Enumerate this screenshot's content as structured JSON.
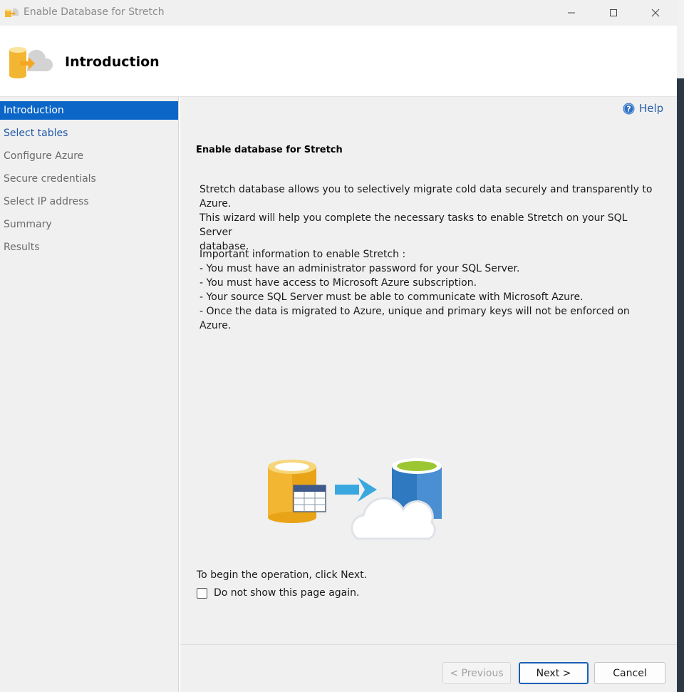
{
  "window": {
    "title": "Enable Database for Stretch"
  },
  "header": {
    "title": "Introduction"
  },
  "nav": {
    "items": [
      {
        "label": "Introduction"
      },
      {
        "label": "Select tables"
      },
      {
        "label": "Configure Azure"
      },
      {
        "label": "Secure credentials"
      },
      {
        "label": "Select IP address"
      },
      {
        "label": "Summary"
      },
      {
        "label": "Results"
      }
    ]
  },
  "help": {
    "label": "Help"
  },
  "content": {
    "section_title": "Enable database for Stretch",
    "intro_lines": [
      "Stretch database allows you to selectively migrate cold data securely and transparently to Azure.",
      "This wizard will help you complete the necessary tasks to enable Stretch on your SQL Server",
      "database."
    ],
    "important_heading": "Important information to enable Stretch :",
    "important_items": [
      "- You must have an administrator password for your SQL Server.",
      "- You must have access to Microsoft Azure subscription.",
      "- Your source SQL Server must be able to communicate with Microsoft Azure.",
      "- Once the data is migrated to Azure, unique and primary keys will not be enforced on Azure."
    ],
    "begin_text": "To begin the operation, click Next.",
    "dont_show_label": "Do not show this page again.",
    "dont_show_checked": false
  },
  "footer": {
    "previous_label": "< Previous",
    "next_label": "Next >",
    "cancel_label": "Cancel"
  },
  "icons": {
    "window": "database-stretch-icon",
    "header": "database-stretch-icon",
    "help": "help-icon",
    "illustration": "database-to-cloud-illustration"
  },
  "colors": {
    "accent": "#0b66c8",
    "link": "#2058a8",
    "database_gold": "#f2b632",
    "database_blue": "#2f79c1",
    "arrow": "#3aa8df"
  }
}
